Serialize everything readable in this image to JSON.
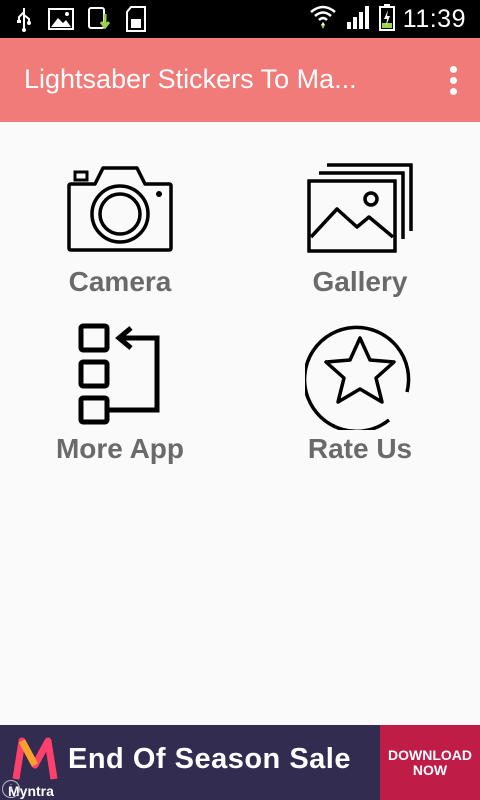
{
  "status_bar": {
    "time": "11:39",
    "icons": [
      "usb-icon",
      "image-icon",
      "download-icon",
      "sd-card-icon",
      "wifi-icon",
      "signal-icon",
      "battery-charging-icon"
    ]
  },
  "app_bar": {
    "title": "Lightsaber Stickers To Ma...",
    "menu_icon": "overflow-menu-icon"
  },
  "tiles": [
    {
      "label": "Camera",
      "icon": "camera-icon"
    },
    {
      "label": "Gallery",
      "icon": "gallery-icon"
    },
    {
      "label": "More App",
      "icon": "more-apps-icon"
    },
    {
      "label": "Rate Us",
      "icon": "star-icon"
    }
  ],
  "ad": {
    "brand": "Myntra",
    "text": "End Of Season Sale",
    "cta": "DOWNLOAD\nNOW",
    "info": "i",
    "colors": {
      "background": "#312c50",
      "cta": "#bf1c47"
    }
  },
  "colors": {
    "app_bar": "#f07b78",
    "tile_label": "#6a6a6a",
    "background": "#fafafa"
  }
}
